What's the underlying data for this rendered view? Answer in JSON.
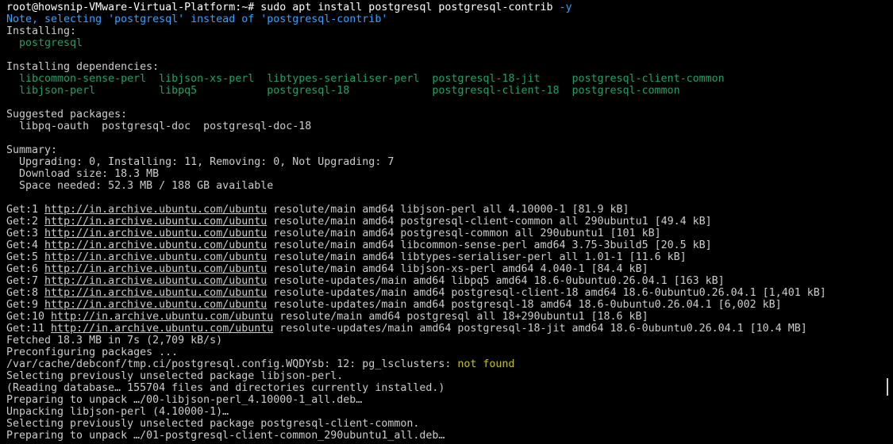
{
  "command": {
    "prompt": "root@howsnip-VMware-Virtual-Platform:~# ",
    "text": "sudo apt install postgresql postgresql-contrib ",
    "flag": "-y"
  },
  "note": "Note, selecting 'postgresql' instead of 'postgresql-contrib'",
  "installing": {
    "header": "Installing:",
    "packages": "  postgresql"
  },
  "deps": {
    "header": "Installing dependencies:",
    "row1": "  libcommon-sense-perl  libjson-xs-perl  libtypes-serialiser-perl  postgresql-18-jit     postgresql-client-common",
    "row2": "  libjson-perl          libpq5           postgresql-18             postgresql-client-18  postgresql-common"
  },
  "suggested": {
    "header": "Suggested packages:",
    "packages": "  libpq-oauth  postgresql-doc  postgresql-doc-18"
  },
  "summary": {
    "header": "Summary:",
    "line1": "  Upgrading: 0, Installing: 11, Removing: 0, Not Upgrading: 7",
    "line2": "  Download size: 18.3 MB",
    "line3": "  Space needed: 52.3 MB / 188 GB available"
  },
  "gets": [
    {
      "prefix": "Get:1 ",
      "url": "http://in.archive.ubuntu.com/ubuntu",
      "rest": " resolute/main amd64 libjson-perl all 4.10000-1 [81.9 kB]"
    },
    {
      "prefix": "Get:2 ",
      "url": "http://in.archive.ubuntu.com/ubuntu",
      "rest": " resolute/main amd64 postgresql-client-common all 290ubuntu1 [49.4 kB]"
    },
    {
      "prefix": "Get:3 ",
      "url": "http://in.archive.ubuntu.com/ubuntu",
      "rest": " resolute/main amd64 postgresql-common all 290ubuntu1 [101 kB]"
    },
    {
      "prefix": "Get:4 ",
      "url": "http://in.archive.ubuntu.com/ubuntu",
      "rest": " resolute/main amd64 libcommon-sense-perl amd64 3.75-3build5 [20.5 kB]"
    },
    {
      "prefix": "Get:5 ",
      "url": "http://in.archive.ubuntu.com/ubuntu",
      "rest": " resolute/main amd64 libtypes-serialiser-perl all 1.01-1 [11.6 kB]"
    },
    {
      "prefix": "Get:6 ",
      "url": "http://in.archive.ubuntu.com/ubuntu",
      "rest": " resolute/main amd64 libjson-xs-perl amd64 4.040-1 [84.4 kB]"
    },
    {
      "prefix": "Get:7 ",
      "url": "http://in.archive.ubuntu.com/ubuntu",
      "rest": " resolute-updates/main amd64 libpq5 amd64 18.6-0ubuntu0.26.04.1 [163 kB]"
    },
    {
      "prefix": "Get:8 ",
      "url": "http://in.archive.ubuntu.com/ubuntu",
      "rest": " resolute-updates/main amd64 postgresql-client-18 amd64 18.6-0ubuntu0.26.04.1 [1,401 kB]"
    },
    {
      "prefix": "Get:9 ",
      "url": "http://in.archive.ubuntu.com/ubuntu",
      "rest": " resolute-updates/main amd64 postgresql-18 amd64 18.6-0ubuntu0.26.04.1 [6,002 kB]"
    },
    {
      "prefix": "Get:10 ",
      "url": "http://in.archive.ubuntu.com/ubuntu",
      "rest": " resolute/main amd64 postgresql all 18+290ubuntu1 [18.6 kB]"
    },
    {
      "prefix": "Get:11 ",
      "url": "http://in.archive.ubuntu.com/ubuntu",
      "rest": " resolute-updates/main amd64 postgresql-18-jit amd64 18.6-0ubuntu0.26.04.1 [10.4 MB]"
    }
  ],
  "tail": {
    "fetched": "Fetched 18.3 MB in 7s (2,709 kB/s)",
    "preconfig": "Preconfiguring packages ...",
    "debconf_path": "/var/cache/debconf/tmp.ci/postgresql.config.WQDYsb: 12: pg_lsclusters: ",
    "not_found": "not found",
    "sel1": "Selecting previously unselected package libjson-perl.",
    "reading": "(Reading database… 155704 files and directories currently installed.)",
    "prep1": "Preparing to unpack …/00-libjson-perl_4.10000-1_all.deb…",
    "unpack1": "Unpacking libjson-perl (4.10000-1)…",
    "sel2": "Selecting previously unselected package postgresql-client-common.",
    "prep2": "Preparing to unpack …/01-postgresql-client-common_290ubuntu1_all.deb…"
  },
  "colors": {
    "background": "#000000",
    "text": "#cccccc",
    "note_blue": "#2fa4ff",
    "package_green": "#1fa067",
    "warning_yellow": "#c3c01b"
  }
}
